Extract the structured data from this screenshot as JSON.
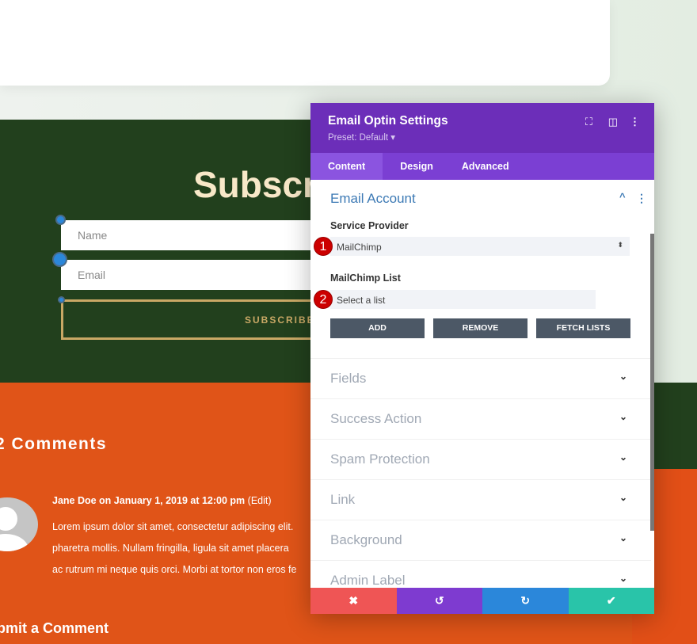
{
  "page": {
    "subscribe_title": "Subscri",
    "name_placeholder": "Name",
    "email_placeholder": "Email",
    "subscribe_button": "SUBSCRIBE",
    "comments_heading": "2 Comments",
    "comment_author": "Jane Doe on January 1, 2019 at 12:00 pm",
    "comment_edit": "(Edit)",
    "comment_lines": [
      "Lorem ipsum dolor sit amet, consectetur adipiscing elit.",
      "pharetra mollis. Nullam fringilla, ligula sit amet placera",
      "ac rutrum mi neque quis orci. Morbi at tortor non eros fe"
    ],
    "submit_heading": "bmit a Comment"
  },
  "panel": {
    "title": "Email Optin Settings",
    "preset": "Preset: Default ▾",
    "icons": [
      "expand-icon",
      "split-view-icon",
      "more-icon"
    ],
    "tabs": [
      {
        "label": "Content",
        "active": true
      },
      {
        "label": "Design"
      },
      {
        "label": "Advanced"
      }
    ],
    "section_title": "Email Account",
    "service_provider_label": "Service Provider",
    "service_provider_value": "MailChimp",
    "list_label": "MailChimp List",
    "list_value": "Select a list",
    "badges": [
      "1",
      "2"
    ],
    "buttons": {
      "add": "ADD",
      "remove": "REMOVE",
      "fetch": "FETCH LISTS"
    },
    "sections": [
      "Fields",
      "Success Action",
      "Spam Protection",
      "Link",
      "Background",
      "Admin Label"
    ],
    "footer": {
      "cancel": "✖",
      "undo": "↺",
      "redo": "↻",
      "save": "✔"
    }
  },
  "colors": {
    "header": "#6c2eb9",
    "tabs": "#7b3fd3",
    "cancel": "#ef5555",
    "undo": "#7e3bd0",
    "redo": "#2b87da",
    "save": "#29c4a9",
    "green": "#22401d",
    "orange": "#e05418"
  }
}
